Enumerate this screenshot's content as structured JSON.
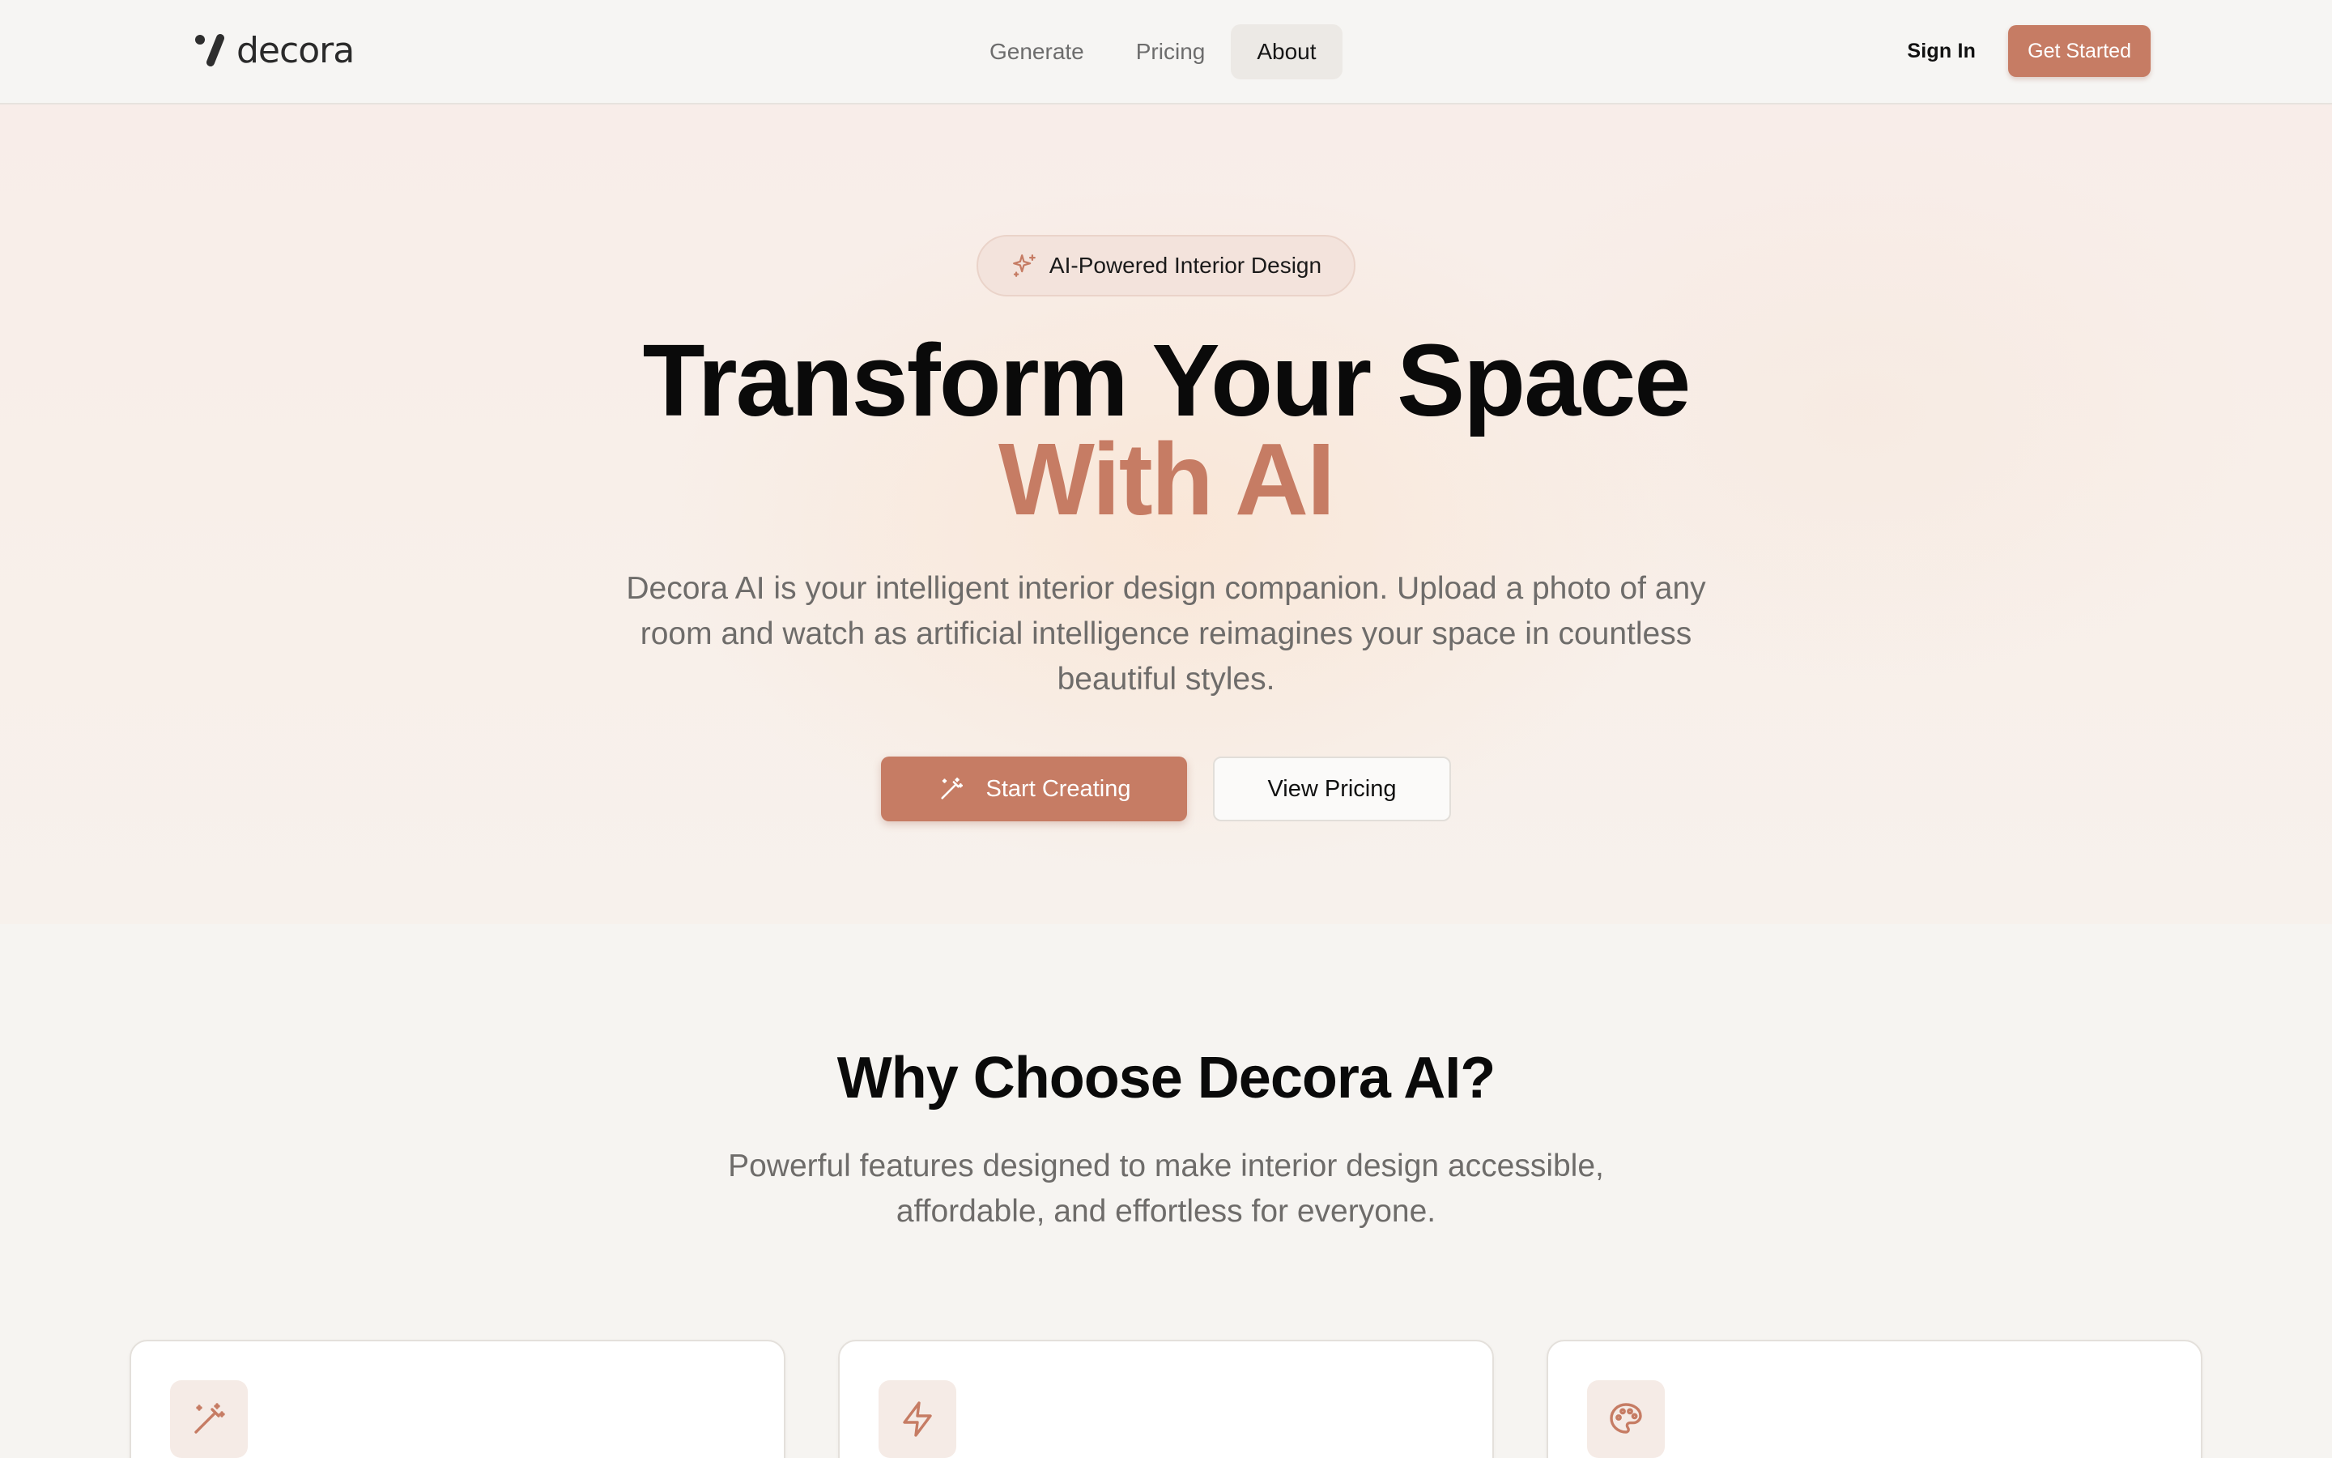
{
  "brand": {
    "name": "decora",
    "accent": "#c67c64"
  },
  "nav": {
    "links": [
      {
        "label": "Generate"
      },
      {
        "label": "Pricing"
      },
      {
        "label": "About",
        "active": true
      }
    ],
    "sign_in": "Sign In",
    "get_started": "Get Started"
  },
  "hero": {
    "badge": "AI-Powered Interior Design",
    "badge_icon": "sparkles-icon",
    "title_line1": "Transform Your Space",
    "title_line2": "With AI",
    "description": "Decora AI is your intelligent interior design companion. Upload a photo of any room and watch as artificial intelligence reimagines your space in countless beautiful styles.",
    "primary_cta": "Start Creating",
    "primary_cta_icon": "magic-wand-icon",
    "secondary_cta": "View Pricing"
  },
  "features": {
    "title": "Why Choose Decora AI?",
    "description": "Powerful features designed to make interior design accessible, affordable, and effortless for everyone.",
    "cards": [
      {
        "icon": "magic-wand-icon"
      },
      {
        "icon": "lightning-icon"
      },
      {
        "icon": "palette-icon"
      }
    ]
  }
}
